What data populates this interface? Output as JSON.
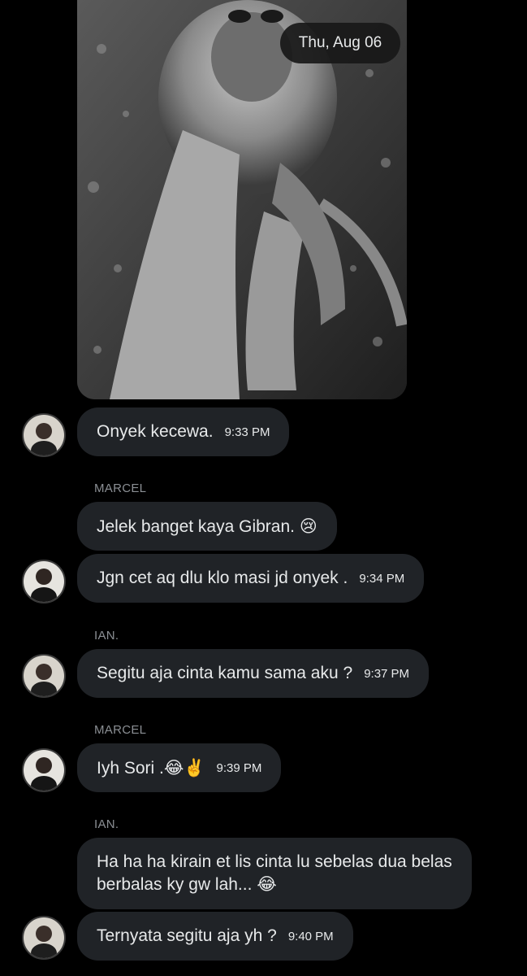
{
  "header": {
    "date": "Thu, Aug 06"
  },
  "colors": {
    "bubble": "#202327",
    "background": "#000000",
    "sender": "#8b8f94"
  },
  "messages": [
    {
      "text": "Onyek kecewa.",
      "time": "9:33 PM"
    },
    {
      "sender": "MARCEL",
      "text": "Jelek banget kaya Gibran. 😢"
    },
    {
      "text": "Jgn cet aq dlu klo masi jd onyek .",
      "time": "9:34 PM"
    },
    {
      "sender": "IAN.",
      "text": "Segitu aja cinta kamu sama aku ?",
      "time": "9:37 PM"
    },
    {
      "sender": "MARCEL",
      "text": "Iyh Sori .😂✌️",
      "time": "9:39 PM"
    },
    {
      "sender": "IAN.",
      "text": "Ha ha ha kirain et lis cinta lu sebelas dua belas berbalas ky gw lah... 😂"
    },
    {
      "text": "Ternyata segitu aja yh ?",
      "time": "9:40 PM"
    }
  ]
}
